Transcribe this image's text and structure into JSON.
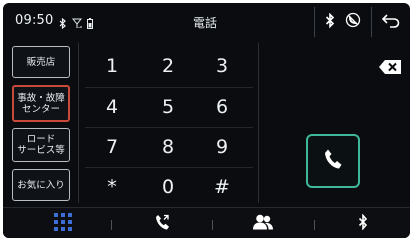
{
  "status_bar": {
    "time": "09:50",
    "title": "電話",
    "icons": [
      "bluetooth-icon",
      "signal-icon",
      "battery-icon"
    ]
  },
  "top_right": {
    "icons": [
      "bluetooth-icon",
      "no-phone-icon",
      "back-arrow-icon"
    ]
  },
  "left_buttons": [
    {
      "label": "販売店"
    },
    {
      "label": "事故・故障\nセンター",
      "selected": true
    },
    {
      "label": "ロード\nサービス等"
    },
    {
      "label": "お気に入り"
    }
  ],
  "keypad": {
    "keys": [
      "1",
      "2",
      "3",
      "4",
      "5",
      "6",
      "7",
      "8",
      "9",
      "*",
      "0",
      "#"
    ]
  },
  "actions": {
    "backspace_icon": "backspace-icon",
    "call_icon": "phone-call-icon"
  },
  "bottom_tabs": [
    {
      "icon": "keypad-icon",
      "active": true
    },
    {
      "icon": "call-history-icon"
    },
    {
      "icon": "contacts-icon"
    },
    {
      "icon": "bluetooth-icon"
    }
  ],
  "colors": {
    "accent_blue": "#3b6fd6",
    "call_green": "#3fb79b",
    "selected_red": "#c94a3a"
  }
}
